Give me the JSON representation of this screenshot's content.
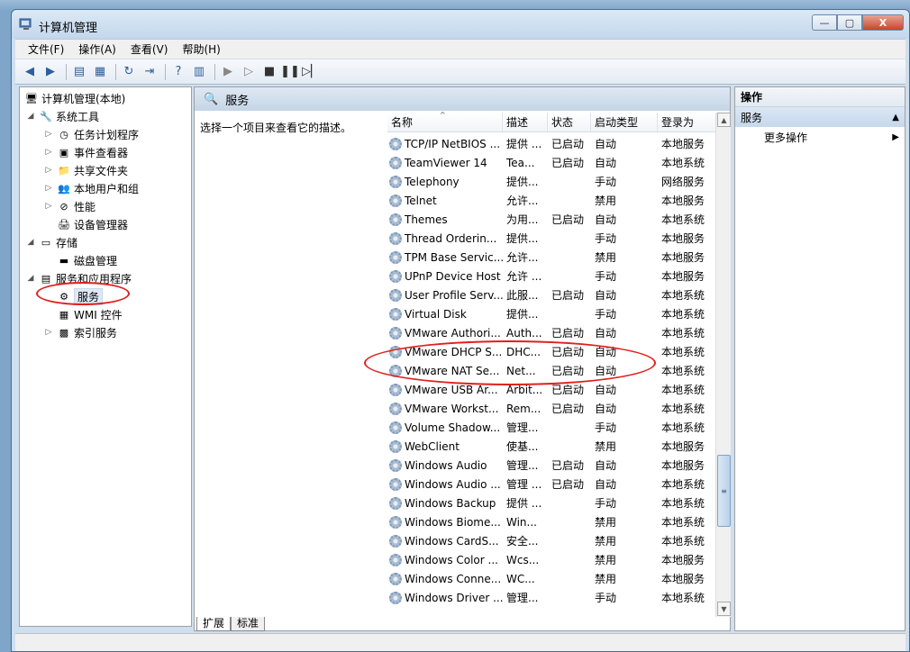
{
  "window": {
    "title": "计算机管理",
    "minimize": "—",
    "maximize": "▢",
    "close": "X"
  },
  "menu": [
    "文件(F)",
    "操作(A)",
    "查看(V)",
    "帮助(H)"
  ],
  "toolbar_icons": [
    "back-icon",
    "forward-icon",
    "up-folder-icon",
    "show-hide-tree-icon",
    "refresh-icon",
    "export-icon",
    "help-icon",
    "view-icon",
    "play-icon",
    "play-alt-icon",
    "stop-icon",
    "pause-icon",
    "restart-icon"
  ],
  "tree": {
    "root": "计算机管理(本地)",
    "system_tools": "系统工具",
    "task_scheduler": "任务计划程序",
    "event_viewer": "事件查看器",
    "shared_folders": "共享文件夹",
    "local_users": "本地用户和组",
    "performance": "性能",
    "device_manager": "设备管理器",
    "storage": "存储",
    "disk_management": "磁盘管理",
    "services_apps": "服务和应用程序",
    "services": "服务",
    "wmi": "WMI 控件",
    "indexing": "索引服务"
  },
  "center": {
    "header": "服务",
    "description": "选择一个项目来查看它的描述。",
    "columns": {
      "name": "名称",
      "desc": "描述",
      "status": "状态",
      "startup": "启动类型",
      "logon": "登录为"
    },
    "rows": [
      {
        "name": "TCP/IP NetBIOS ...",
        "desc": "提供 ...",
        "status": "已启动",
        "startup": "自动",
        "logon": "本地服务"
      },
      {
        "name": "TeamViewer 14",
        "desc": "Tea...",
        "status": "已启动",
        "startup": "自动",
        "logon": "本地系统"
      },
      {
        "name": "Telephony",
        "desc": "提供...",
        "status": "",
        "startup": "手动",
        "logon": "网络服务"
      },
      {
        "name": "Telnet",
        "desc": "允许...",
        "status": "",
        "startup": "禁用",
        "logon": "本地服务"
      },
      {
        "name": "Themes",
        "desc": "为用...",
        "status": "已启动",
        "startup": "自动",
        "logon": "本地系统"
      },
      {
        "name": "Thread Orderin...",
        "desc": "提供...",
        "status": "",
        "startup": "手动",
        "logon": "本地服务"
      },
      {
        "name": "TPM Base Servic...",
        "desc": "允许...",
        "status": "",
        "startup": "禁用",
        "logon": "本地服务"
      },
      {
        "name": "UPnP Device Host",
        "desc": "允许 ...",
        "status": "",
        "startup": "手动",
        "logon": "本地服务"
      },
      {
        "name": "User Profile Serv...",
        "desc": "此服...",
        "status": "已启动",
        "startup": "自动",
        "logon": "本地系统"
      },
      {
        "name": "Virtual Disk",
        "desc": "提供...",
        "status": "",
        "startup": "手动",
        "logon": "本地系统"
      },
      {
        "name": "VMware Authori...",
        "desc": "Auth...",
        "status": "已启动",
        "startup": "自动",
        "logon": "本地系统"
      },
      {
        "name": "VMware DHCP S...",
        "desc": "DHC...",
        "status": "已启动",
        "startup": "自动",
        "logon": "本地系统"
      },
      {
        "name": "VMware NAT Se...",
        "desc": "Net...",
        "status": "已启动",
        "startup": "自动",
        "logon": "本地系统"
      },
      {
        "name": "VMware USB Ar...",
        "desc": "Arbit...",
        "status": "已启动",
        "startup": "自动",
        "logon": "本地系统"
      },
      {
        "name": "VMware Workst...",
        "desc": "Rem...",
        "status": "已启动",
        "startup": "自动",
        "logon": "本地系统"
      },
      {
        "name": "Volume Shadow...",
        "desc": "管理...",
        "status": "",
        "startup": "手动",
        "logon": "本地系统"
      },
      {
        "name": "WebClient",
        "desc": "使基...",
        "status": "",
        "startup": "禁用",
        "logon": "本地服务"
      },
      {
        "name": "Windows Audio",
        "desc": "管理...",
        "status": "已启动",
        "startup": "自动",
        "logon": "本地服务"
      },
      {
        "name": "Windows Audio ...",
        "desc": "管理 ...",
        "status": "已启动",
        "startup": "自动",
        "logon": "本地系统"
      },
      {
        "name": "Windows Backup",
        "desc": "提供 ...",
        "status": "",
        "startup": "手动",
        "logon": "本地系统"
      },
      {
        "name": "Windows Biome...",
        "desc": "Win...",
        "status": "",
        "startup": "禁用",
        "logon": "本地系统"
      },
      {
        "name": "Windows CardS...",
        "desc": "安全...",
        "status": "",
        "startup": "禁用",
        "logon": "本地系统"
      },
      {
        "name": "Windows Color ...",
        "desc": "Wcs...",
        "status": "",
        "startup": "禁用",
        "logon": "本地服务"
      },
      {
        "name": "Windows Conne...",
        "desc": "WC...",
        "status": "",
        "startup": "禁用",
        "logon": "本地服务"
      },
      {
        "name": "Windows Driver ...",
        "desc": "管理...",
        "status": "",
        "startup": "手动",
        "logon": "本地系统"
      }
    ],
    "tabs": [
      "扩展",
      "标准"
    ]
  },
  "actions": {
    "title": "操作",
    "section": "服务",
    "more": "更多操作"
  },
  "colors": {
    "highlight_oval": "#e0201e",
    "header_blue": "#c5d5e7"
  }
}
